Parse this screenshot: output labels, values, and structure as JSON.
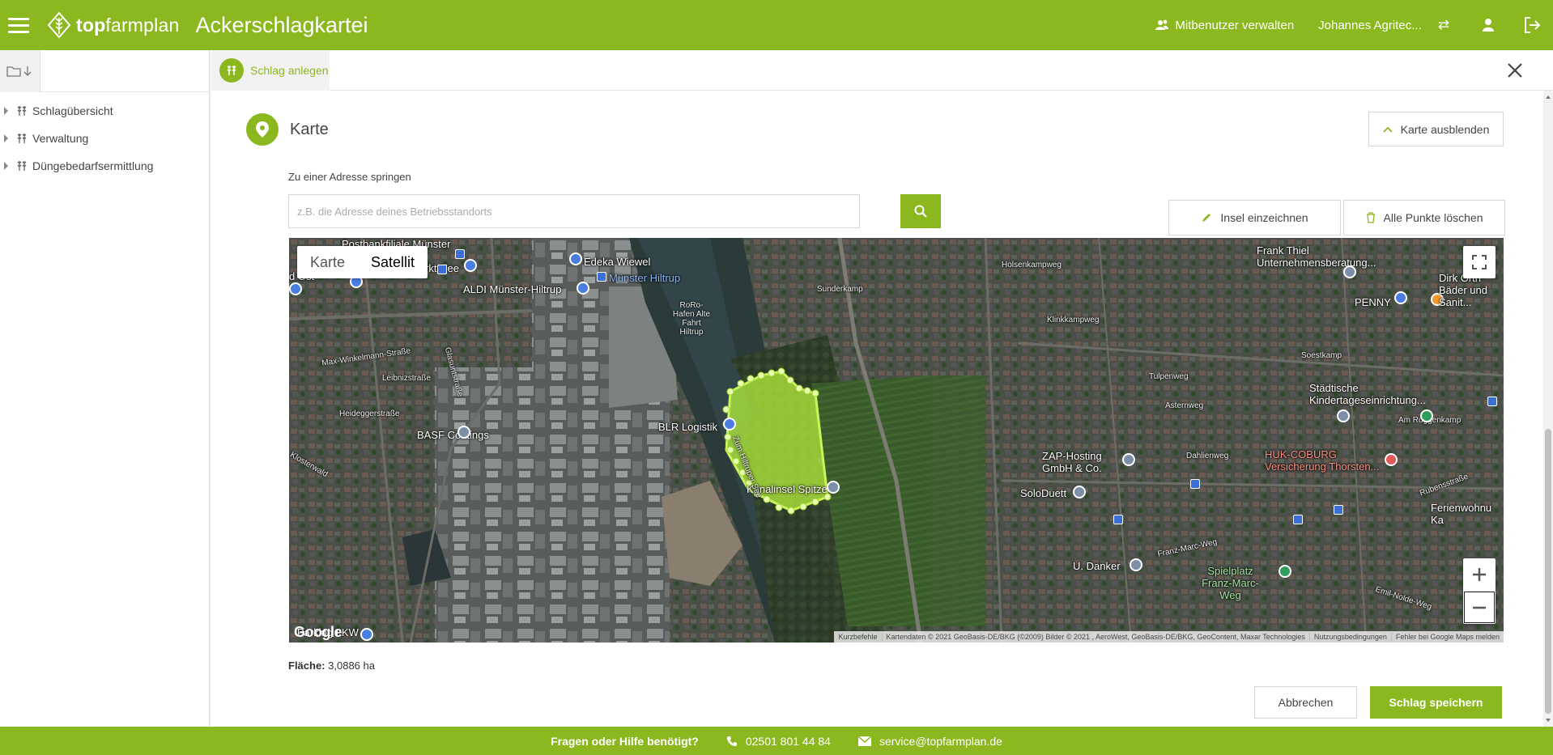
{
  "header": {
    "logo_bold": "top",
    "logo_rest": "farmplan",
    "app_title": "Ackerschlagkartei",
    "share_label": "Mitbenutzer verwalten",
    "user_name": "Johannes Agritec..."
  },
  "sidebar": {
    "items": [
      {
        "label": "Schlagübersicht"
      },
      {
        "label": "Verwaltung"
      },
      {
        "label": "Düngebedarfsermittlung"
      }
    ]
  },
  "tabbar": {
    "active_tab": "Schlag anlegen"
  },
  "section": {
    "title": "Karte",
    "hide_map_label": "Karte ausblenden"
  },
  "address": {
    "label": "Zu einer Adresse springen",
    "placeholder": "z.B. die Adresse deines Betriebsstandorts"
  },
  "map_tools": {
    "island_label": "Insel einzeichnen",
    "delete_points_label": "Alle Punkte löschen"
  },
  "map": {
    "type_options": [
      "Karte",
      "Satellit"
    ],
    "active_type": "Satellit",
    "google_label": "Google",
    "attribution": [
      "Kurzbefehle",
      "Kartendaten © 2021 GeoBasis-DE/BKG (©2009) Bilder © 2021 , AeroWest, GeoBasis-DE/BKG, GeoContent, Maxar Technologies",
      "Nutzungsbedingungen",
      "Fehler bei Google Maps melden"
    ],
    "labels": [
      "Postbankfiliale Münster",
      "Marktallee",
      "d Ost",
      "Edeka Wiewel",
      "ALDI Münster-Hiltrup",
      "Münster Hiltrup",
      "Sunderkamp",
      "RoRo-Hafen Alte Fahrt Hiltrup",
      "Max-Winkelmann-Straße",
      "Leibnizstraße",
      "Heideggerstraße",
      "BASF Coatings",
      "BLR Logistik",
      "Kanalinsel Spitze",
      "Zum Hiltruper See",
      "Parking LKW",
      "Frank Thiel Unternehmensberatung...",
      "Holsenkampweg",
      "Klinkkampweg",
      "PENNY",
      "Dirk Orth Bäder und Sanit...",
      "Soestkamp",
      "Tulpenweg",
      "Städtische Kindertageseinrichtung...",
      "ZAP-Hosting GmbH & Co.",
      "Asternweg",
      "Am Roggenkamp",
      "HUK-COBURG Versicherung Thorsten...",
      "Dahlienweg",
      "SoloDuett",
      "Rubensstraße",
      "Ferienwohnu Ka",
      "U. Danker",
      "Franz-Marc-Weg",
      "Spielplatz Franz-Marc-Weg",
      "Emil-Nolde-Weg",
      "Glasuritstraße",
      "Klosterwald"
    ]
  },
  "area": {
    "label": "Fläche:",
    "value": "3,0886 ha"
  },
  "actions": {
    "cancel_label": "Abbrechen",
    "save_label": "Schlag speichern"
  },
  "footer": {
    "question": "Fragen oder Hilfe benötigt?",
    "phone": "02501 801 44 84",
    "email": "service@topfarmplan.de"
  },
  "colors": {
    "brand_green": "#8cb81f",
    "field_highlight": "#b5f03c"
  }
}
